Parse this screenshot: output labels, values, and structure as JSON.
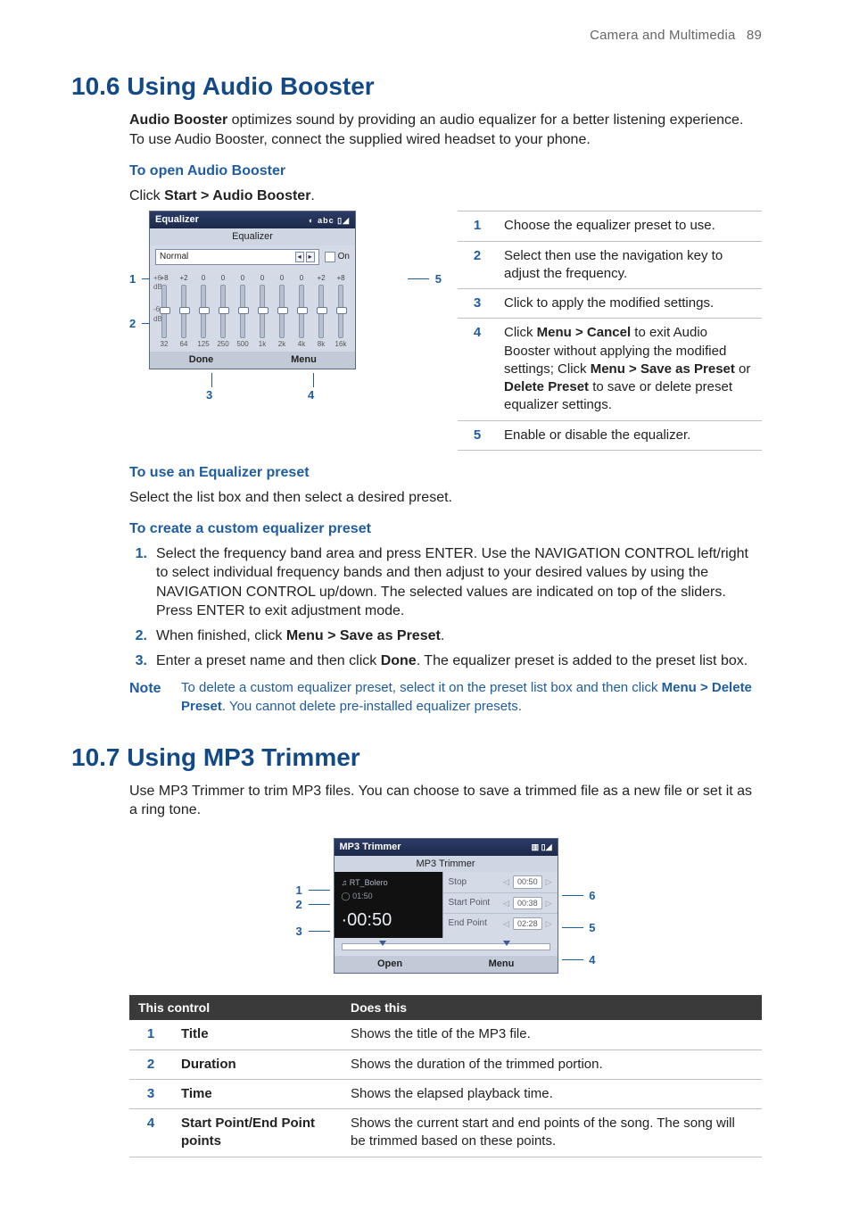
{
  "header": {
    "section": "Camera and Multimedia",
    "page": "89"
  },
  "s106": {
    "title": "10.6  Using Audio Booster",
    "intro_bold": "Audio Booster",
    "intro_rest": " optimizes sound by providing an audio equalizer for a better listening experience. To use Audio Booster, connect the supplied wired headset to your phone.",
    "open_sub": "To open Audio Booster",
    "open_cmd_pre": "Click ",
    "open_cmd_bold": "Start > Audio Booster",
    "open_cmd_post": ".",
    "eq": {
      "window_title": "Equalizer",
      "toolbar": "Equalizer",
      "combo": "Normal",
      "on_lbl": "On",
      "tops": [
        "+8",
        "+2",
        "0",
        "0",
        "0",
        "0",
        "0",
        "0",
        "+2",
        "+8"
      ],
      "freqs": [
        "32",
        "64",
        "125",
        "250",
        "500",
        "1k",
        "2k",
        "4k",
        "8k",
        "16k"
      ],
      "scale_top": "+6\ndB",
      "scale_bot": "-6\ndB",
      "done": "Done",
      "menu": "Menu"
    },
    "eqtable": [
      {
        "n": "1",
        "t": "Choose the equalizer preset to use."
      },
      {
        "n": "2",
        "t": "Select then use the navigation key to adjust the frequency."
      },
      {
        "n": "3",
        "t": "Click to apply the modified settings."
      },
      {
        "n": "4",
        "t_pre": "Click ",
        "t_b1": "Menu > Cancel",
        "t_mid1": " to exit Audio Booster without applying the modified settings; Click ",
        "t_b2": "Menu > Save as Preset",
        "t_mid2": " or ",
        "t_b3": "Delete Preset",
        "t_post": " to save or delete preset equalizer settings."
      },
      {
        "n": "5",
        "t": "Enable or disable the equalizer."
      }
    ],
    "use_sub": "To use an Equalizer preset",
    "use_line": "Select the list box and then select a desired preset.",
    "create_sub": "To create a custom equalizer preset",
    "create_steps": [
      "Select the frequency band area and press ENTER. Use the NAVIGATION CONTROL left/right to select individual frequency bands and then adjust to your desired values by using the NAVIGATION CONTROL up/down. The selected values are indicated on top of the sliders. Press ENTER to exit adjustment mode.",
      "When finished, click __B__Menu > Save as Preset__/B__.",
      "Enter a preset name and then click __B__Done__/B__. The equalizer preset is added to the preset list box."
    ],
    "note_lbl": "Note",
    "note_pre": "To delete a custom equalizer preset, select it on the preset list box and then click ",
    "note_b": "Menu > Delete Preset",
    "note_post": ". You cannot delete pre-installed equalizer presets."
  },
  "s107": {
    "title": "10.7  Using MP3 Trimmer",
    "intro": "Use MP3 Trimmer to trim MP3 files. You can choose to save a trimmed file as a new file or set it as a ring tone.",
    "mp3": {
      "window_title": "MP3 Trimmer",
      "toolbar": "MP3 Trimmer",
      "song": "♫ RT_Bolero",
      "dur": "◯ 01:50",
      "big": "00:50",
      "rows": [
        {
          "lbl": "Stop",
          "val": "00:50"
        },
        {
          "lbl": "Start Point",
          "val": "00:38"
        },
        {
          "lbl": "End Point",
          "val": "02:28"
        }
      ],
      "open": "Open",
      "menu": "Menu"
    },
    "tbl": {
      "h1": "This control",
      "h2": "Does this",
      "rows": [
        {
          "n": "1",
          "name": "Title",
          "desc": "Shows the title of the MP3 file."
        },
        {
          "n": "2",
          "name": "Duration",
          "desc": "Shows the duration of the trimmed portion."
        },
        {
          "n": "3",
          "name": "Time",
          "desc": "Shows the elapsed playback time."
        },
        {
          "n": "4",
          "name": "Start Point/End Point points",
          "desc": "Shows the current start and end points of the song. The song will be trimmed based on these points."
        }
      ]
    }
  },
  "callouts": {
    "c1": "1",
    "c2": "2",
    "c3": "3",
    "c4": "4",
    "c5": "5",
    "c6": "6"
  }
}
